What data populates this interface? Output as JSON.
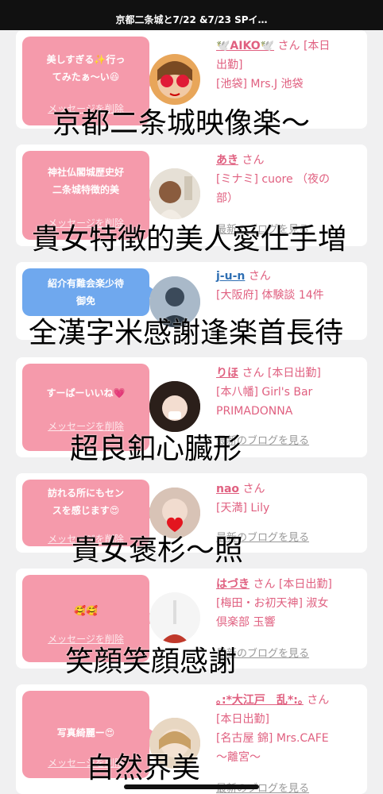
{
  "status_bar": {
    "title": "京都二条城と7/22 &7/23 SPイ…"
  },
  "cards": [
    {
      "message": "美しすぎる✨行っ\nてみたぁ〜い😆",
      "delete_label": "メッセージを削除",
      "name": "🕊️AIKO🕊️",
      "san": "さん",
      "status": "[本日\n出勤]",
      "shop": "[池袋] Mrs.J 池袋",
      "blog_link": ""
    },
    {
      "message": "神社仏閣城歴史好\n二条城特徴的美",
      "delete_label": "メッセージを削除",
      "name": "あき",
      "san": "さん",
      "status": "",
      "shop": "[ミナミ] cuore （夜の\n部）",
      "blog_link": "最新のブログを見る"
    },
    {
      "message": "紹介有難会楽少待\n御免",
      "delete_label": "",
      "name": "j-u-n",
      "san": "さん",
      "status": "",
      "shop": "[大阪府] 体験談 14件",
      "blog_link": ""
    },
    {
      "message": "すーぱーいいね💗",
      "delete_label": "メッセージを削除",
      "name": "りほ",
      "san": "さん",
      "status": "[本日出勤]",
      "shop": "[本八幡] Girl's Bar\nPRIMADONNA",
      "blog_link": "最新のブログを見る"
    },
    {
      "message": "訪れる所にもセン\nスを感じます😍",
      "delete_label": "メッセージを削除",
      "name": "nao",
      "san": "さん",
      "status": "",
      "shop": "[天満] Lily",
      "blog_link": "最新のブログを見る"
    },
    {
      "message": "🥰🥰",
      "delete_label": "メッセージを削除",
      "name": "はづき",
      "san": "さん",
      "status": "[本日出勤]",
      "shop": "[梅田・お初天神] 淑女\n倶楽部 玉響",
      "blog_link": "最新のブログを見る"
    },
    {
      "message": "写真綺麗ー😍",
      "delete_label": "メッセージを削除",
      "name": "｡:*大江戸　乱*:｡",
      "san": "さん",
      "status": "[本日出勤]",
      "shop": "[名古屋 錦] Mrs.CAFE\n〜離宮〜",
      "blog_link": "最新のブログを見る"
    }
  ],
  "overlays": [
    "京都二条城映像楽〜",
    "貴女特徴的美人愛仕手増",
    "全漢字米感謝逢楽首長待",
    "超良釦心臓形",
    "貴女褒杉〜照",
    "笑顔笑顔感謝",
    "自然界美"
  ],
  "colors": {
    "bubble_pink": "#f59aab",
    "bubble_blue": "#6fa8ee",
    "name_pink": "#e06080",
    "name_blue": "#2f6fb3"
  }
}
